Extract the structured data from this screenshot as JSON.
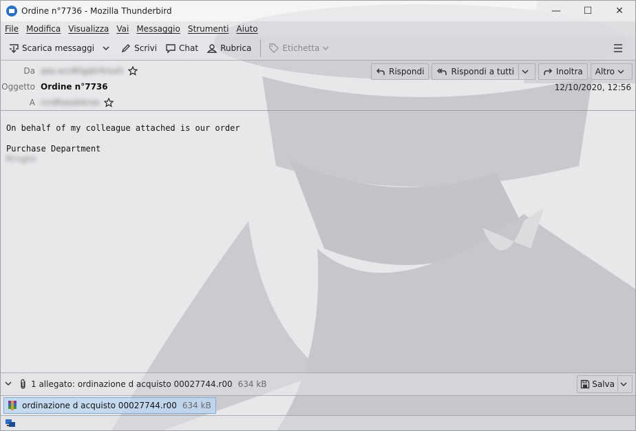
{
  "window": {
    "title": "Ordine n°7736 - Mozilla Thunderbird",
    "minimize": "—",
    "maximize": "☐",
    "close": "✕"
  },
  "menu": [
    "File",
    "Modifica",
    "Visualizza",
    "Vai",
    "Messaggio",
    "Strumenti",
    "Aiuto"
  ],
  "toolbar": {
    "get_messages": "Scarica messaggi",
    "write": "Scrivi",
    "chat": "Chat",
    "address_book": "Rubrica",
    "tag": "Etichetta"
  },
  "header": {
    "from_label": "Da",
    "from_value": "aes-scrdttgqhrkrsxh",
    "subject_label": "Oggetto",
    "subject_value": "Ordine n°7736",
    "to_label": "A",
    "to_value": "rcrdfsesdrkrso",
    "date": "12/10/2020, 12:56",
    "reply": "Rispondi",
    "reply_all": "Rispondi a tutti",
    "forward": "Inoltra",
    "more": "Altro"
  },
  "body": {
    "line1": "On behalf of my colleague attached is our order",
    "line2": "Purchase Department",
    "line3": "Mrnghn"
  },
  "attachments": {
    "summary": "1 allegato: ordinazione d acquisto 00027744.r00",
    "summary_size": "634 kB",
    "save": "Salva",
    "file_name": "ordinazione d acquisto 00027744.r00",
    "file_size": "634 kB"
  }
}
